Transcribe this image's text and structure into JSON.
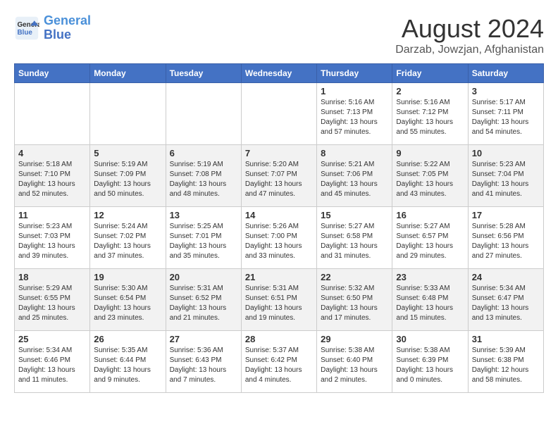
{
  "header": {
    "logo_line1": "General",
    "logo_line2": "Blue",
    "main_title": "August 2024",
    "subtitle": "Darzab, Jowzjan, Afghanistan"
  },
  "days_of_week": [
    "Sunday",
    "Monday",
    "Tuesday",
    "Wednesday",
    "Thursday",
    "Friday",
    "Saturday"
  ],
  "weeks": [
    [
      {
        "day": "",
        "info": ""
      },
      {
        "day": "",
        "info": ""
      },
      {
        "day": "",
        "info": ""
      },
      {
        "day": "",
        "info": ""
      },
      {
        "day": "1",
        "info": "Sunrise: 5:16 AM\nSunset: 7:13 PM\nDaylight: 13 hours\nand 57 minutes."
      },
      {
        "day": "2",
        "info": "Sunrise: 5:16 AM\nSunset: 7:12 PM\nDaylight: 13 hours\nand 55 minutes."
      },
      {
        "day": "3",
        "info": "Sunrise: 5:17 AM\nSunset: 7:11 PM\nDaylight: 13 hours\nand 54 minutes."
      }
    ],
    [
      {
        "day": "4",
        "info": "Sunrise: 5:18 AM\nSunset: 7:10 PM\nDaylight: 13 hours\nand 52 minutes."
      },
      {
        "day": "5",
        "info": "Sunrise: 5:19 AM\nSunset: 7:09 PM\nDaylight: 13 hours\nand 50 minutes."
      },
      {
        "day": "6",
        "info": "Sunrise: 5:19 AM\nSunset: 7:08 PM\nDaylight: 13 hours\nand 48 minutes."
      },
      {
        "day": "7",
        "info": "Sunrise: 5:20 AM\nSunset: 7:07 PM\nDaylight: 13 hours\nand 47 minutes."
      },
      {
        "day": "8",
        "info": "Sunrise: 5:21 AM\nSunset: 7:06 PM\nDaylight: 13 hours\nand 45 minutes."
      },
      {
        "day": "9",
        "info": "Sunrise: 5:22 AM\nSunset: 7:05 PM\nDaylight: 13 hours\nand 43 minutes."
      },
      {
        "day": "10",
        "info": "Sunrise: 5:23 AM\nSunset: 7:04 PM\nDaylight: 13 hours\nand 41 minutes."
      }
    ],
    [
      {
        "day": "11",
        "info": "Sunrise: 5:23 AM\nSunset: 7:03 PM\nDaylight: 13 hours\nand 39 minutes."
      },
      {
        "day": "12",
        "info": "Sunrise: 5:24 AM\nSunset: 7:02 PM\nDaylight: 13 hours\nand 37 minutes."
      },
      {
        "day": "13",
        "info": "Sunrise: 5:25 AM\nSunset: 7:01 PM\nDaylight: 13 hours\nand 35 minutes."
      },
      {
        "day": "14",
        "info": "Sunrise: 5:26 AM\nSunset: 7:00 PM\nDaylight: 13 hours\nand 33 minutes."
      },
      {
        "day": "15",
        "info": "Sunrise: 5:27 AM\nSunset: 6:58 PM\nDaylight: 13 hours\nand 31 minutes."
      },
      {
        "day": "16",
        "info": "Sunrise: 5:27 AM\nSunset: 6:57 PM\nDaylight: 13 hours\nand 29 minutes."
      },
      {
        "day": "17",
        "info": "Sunrise: 5:28 AM\nSunset: 6:56 PM\nDaylight: 13 hours\nand 27 minutes."
      }
    ],
    [
      {
        "day": "18",
        "info": "Sunrise: 5:29 AM\nSunset: 6:55 PM\nDaylight: 13 hours\nand 25 minutes."
      },
      {
        "day": "19",
        "info": "Sunrise: 5:30 AM\nSunset: 6:54 PM\nDaylight: 13 hours\nand 23 minutes."
      },
      {
        "day": "20",
        "info": "Sunrise: 5:31 AM\nSunset: 6:52 PM\nDaylight: 13 hours\nand 21 minutes."
      },
      {
        "day": "21",
        "info": "Sunrise: 5:31 AM\nSunset: 6:51 PM\nDaylight: 13 hours\nand 19 minutes."
      },
      {
        "day": "22",
        "info": "Sunrise: 5:32 AM\nSunset: 6:50 PM\nDaylight: 13 hours\nand 17 minutes."
      },
      {
        "day": "23",
        "info": "Sunrise: 5:33 AM\nSunset: 6:48 PM\nDaylight: 13 hours\nand 15 minutes."
      },
      {
        "day": "24",
        "info": "Sunrise: 5:34 AM\nSunset: 6:47 PM\nDaylight: 13 hours\nand 13 minutes."
      }
    ],
    [
      {
        "day": "25",
        "info": "Sunrise: 5:34 AM\nSunset: 6:46 PM\nDaylight: 13 hours\nand 11 minutes."
      },
      {
        "day": "26",
        "info": "Sunrise: 5:35 AM\nSunset: 6:44 PM\nDaylight: 13 hours\nand 9 minutes."
      },
      {
        "day": "27",
        "info": "Sunrise: 5:36 AM\nSunset: 6:43 PM\nDaylight: 13 hours\nand 7 minutes."
      },
      {
        "day": "28",
        "info": "Sunrise: 5:37 AM\nSunset: 6:42 PM\nDaylight: 13 hours\nand 4 minutes."
      },
      {
        "day": "29",
        "info": "Sunrise: 5:38 AM\nSunset: 6:40 PM\nDaylight: 13 hours\nand 2 minutes."
      },
      {
        "day": "30",
        "info": "Sunrise: 5:38 AM\nSunset: 6:39 PM\nDaylight: 13 hours\nand 0 minutes."
      },
      {
        "day": "31",
        "info": "Sunrise: 5:39 AM\nSunset: 6:38 PM\nDaylight: 12 hours\nand 58 minutes."
      }
    ]
  ]
}
